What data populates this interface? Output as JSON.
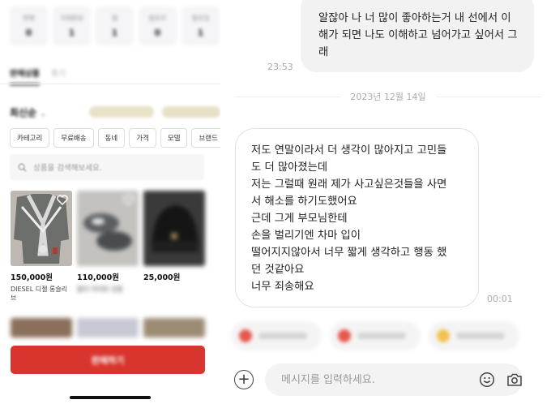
{
  "left_pane": {
    "stats": [
      {
        "label": "판매",
        "value": "0"
      },
      {
        "label": "거래완료",
        "value": "1"
      },
      {
        "label": "찜",
        "value": "1"
      },
      {
        "label": "팔로우",
        "value": "0"
      },
      {
        "label": "팔로잉",
        "value": "1"
      }
    ],
    "tabs": [
      "판매상품",
      "후기"
    ],
    "sort_label": "최신순",
    "filter_chips": [
      "카테고리",
      "무료배송",
      "동네",
      "가격",
      "모델",
      "브랜드"
    ],
    "search_placeholder": "상품을 검색해보세요.",
    "products": [
      {
        "price": "150,000원",
        "title": "DIESEL 디젤 롱슬리브"
      },
      {
        "price": "110,000원",
        "title": "블러 처리된 상품"
      },
      {
        "price": "25,000원",
        "title": ""
      }
    ],
    "cta_label": "판매하기",
    "colors": {
      "accent": "#d8352e"
    }
  },
  "chat": {
    "my_message": "알잖아 나 너 많이 좋아하는거 내 선에서 이해가 되면 나도 이해하고 넘어가고 싶어서 그래",
    "my_message_time": "23:53",
    "date_separator": "2023년 12월 14일",
    "their_message_lines": [
      "저도 연말이라서 더 생각이 많아지고 고민들",
      "도 더 많아졌는데",
      "저는 그럴때 원래 제가 사고싶은것들을 사면",
      "서 해소를 하기도했어요",
      "근데 그게 부모님한테",
      "손을 벌리기엔 차마 입이",
      "떨어지지않아서 너무 짧게 생각하고 행동 했",
      "던 것같아요",
      "너무 죄송해요"
    ],
    "their_message_time": "00:01",
    "input_placeholder": "메시지를 입력하세요.",
    "icons": {
      "add": "plus-icon",
      "emoji": "emoji-icon",
      "camera": "camera-icon"
    }
  }
}
